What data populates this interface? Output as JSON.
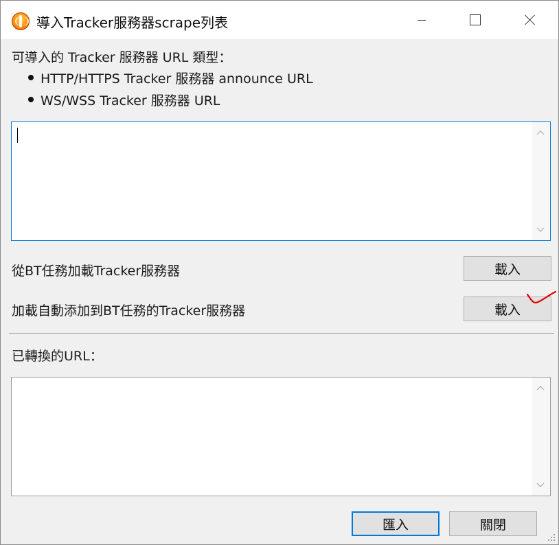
{
  "window": {
    "title": "導入Tracker服務器scrape列表"
  },
  "info": {
    "heading": "可導入的 Tracker 服務器 URL 類型：",
    "items": [
      "HTTP/HTTPS Tracker 服務器 announce URL",
      "WS/WSS Tracker 服務器 URL"
    ]
  },
  "input": {
    "value": ""
  },
  "load_from_task": {
    "label": "從BT任務加載Tracker服務器",
    "button": "載入"
  },
  "load_auto": {
    "label": "加載自動添加到BT任務的Tracker服務器",
    "button": "載入"
  },
  "converted": {
    "label": "已轉換的URL：",
    "value": ""
  },
  "footer": {
    "import_button": "匯入",
    "close_button": "關閉"
  },
  "colors": {
    "focus_border": "#0078d7",
    "annotation": "#e00000"
  }
}
